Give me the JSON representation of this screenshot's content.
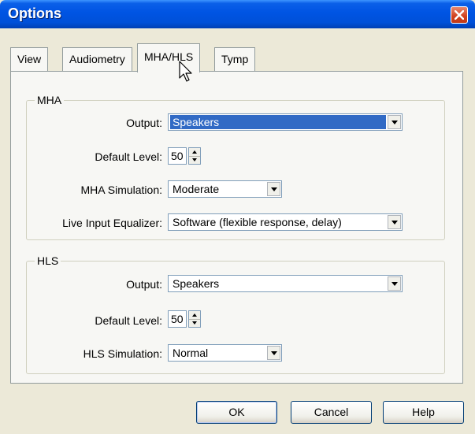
{
  "window": {
    "title": "Options"
  },
  "tabs": [
    {
      "label": "View"
    },
    {
      "label": "Audiometry"
    },
    {
      "label": "MHA/HLS",
      "active": true
    },
    {
      "label": "Tymp"
    }
  ],
  "mha": {
    "legend": "MHA",
    "output": {
      "label": "Output:",
      "value": "Speakers"
    },
    "default_level": {
      "label": "Default Level:",
      "value": "50"
    },
    "simulation": {
      "label": "MHA Simulation:",
      "value": "Moderate"
    },
    "equalizer": {
      "label": "Live Input Equalizer:",
      "value": "Software (flexible response, delay)"
    }
  },
  "hls": {
    "legend": "HLS",
    "output": {
      "label": "Output:",
      "value": "Speakers"
    },
    "default_level": {
      "label": "Default Level:",
      "value": "50"
    },
    "simulation": {
      "label": "HLS Simulation:",
      "value": "Normal"
    }
  },
  "buttons": {
    "ok": "OK",
    "cancel": "Cancel",
    "help": "Help"
  },
  "icons": {
    "close": "close-icon",
    "combo_arrow": "chevron-down-icon",
    "cursor": "mouse-pointer-icon"
  },
  "colors": {
    "titlebar": "#0054e3",
    "selection": "#316ac5",
    "close": "#d0401d"
  }
}
